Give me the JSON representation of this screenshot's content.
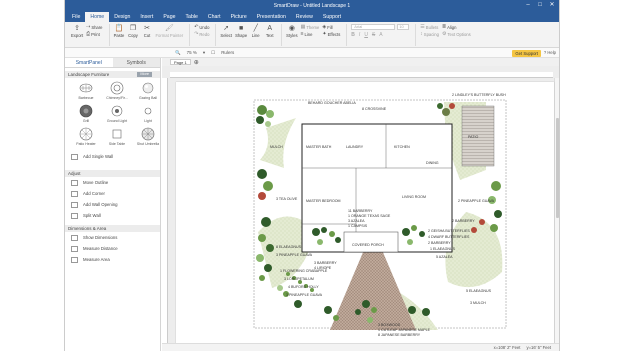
{
  "window": {
    "title": "SmartDraw - Untitled Landscape 1",
    "controls": [
      "–",
      "□",
      "✕"
    ]
  },
  "menu": {
    "items": [
      "File",
      "Home",
      "Design",
      "Insert",
      "Page",
      "Table",
      "Chart",
      "Picture",
      "Presentation",
      "Review",
      "Support"
    ],
    "active": "Home"
  },
  "ribbon": {
    "export": "Export",
    "share": "Share",
    "print": "Print",
    "paste": "Paste",
    "copy": "Copy",
    "cut": "Cut",
    "format_painter": "Format Painter",
    "undo": "Undo",
    "redo": "Redo",
    "select": "Select",
    "shape": "Shape",
    "line": "Line",
    "text": "Text",
    "styles": "Styles",
    "theme": "Theme",
    "fill": "Fill",
    "line_style": "Line",
    "effects": "Effects",
    "font": "Arial",
    "font_size": "10",
    "bullets": "Bullets",
    "align": "Align",
    "spacing": "Spacing",
    "text_options": "Text Options"
  },
  "toolbar2": {
    "zoom": "75 %",
    "rulers": "Rulers",
    "get_support": "Get Support",
    "help": "Help"
  },
  "sidebar": {
    "tabs": [
      "SmartPanel",
      "Symbols"
    ],
    "section": "Landscape Furniture",
    "more": "More",
    "symbols": [
      "Barbecue",
      "Chimney/Fir...",
      "Gazing Ball",
      "Grill",
      "Ground Light",
      "Light",
      "Patio Heater",
      "Side Table",
      "Shut Umbrella"
    ],
    "add_single_wall": "Add Single Wall",
    "adjust_title": "Adjust",
    "adjust_items": [
      "Move Outline",
      "Add Corner",
      "Add Wall Opening",
      "Split Wall"
    ],
    "dims_title": "Dimensions & Area",
    "dims_items": [
      "Show Dimensions",
      "Measure Distance",
      "Measure Area"
    ]
  },
  "canvas": {
    "page_tab": "Page 1"
  },
  "status": {
    "left": "x=108' 2\" Feet",
    "right": "y=16' 5\" Feet"
  },
  "plan": {
    "rooms": [
      "MASTER BATH",
      "LAUNDRY",
      "KITCHEN",
      "DINING",
      "MASTER BEDROOM",
      "LIVING ROOM",
      "COVERED PORCH"
    ],
    "top_labels": [
      "BEHARD GOUCHER ABELIA",
      "8 CROSSVINE",
      "2 LINDLEY'S BUTTERFLY BUSH",
      "PATIO"
    ],
    "left_labels": [
      "MULCH",
      "3 TEA OLIVE",
      "8 ELAEAGNUS",
      "3 PINEAPPLE GUAVA",
      "1 FLOWERING CRABAPPLE",
      "3 LOROPETALUM",
      "4 BUFORD HOLLY",
      "3 PINEAPPLE GUAVA"
    ],
    "center_labels": [
      "11 BARBERRY",
      "1 ORANGE TEXAS SAGE",
      "3 AZALEA",
      "1 CAMPSIS",
      "3 BARBERRY",
      "4 LIRIOPE"
    ],
    "right_labels": [
      "2 PINEAPPLE GUAVA",
      "2 BARBERRY",
      "2 GEISHA BUTTERFLIES",
      "4 DWARF BUTTERFLIES",
      "2 BARBERRY",
      "1 ELAEAGNUS",
      "5 AZALEA",
      "5 ELAEAGNUS",
      "3 MULCH"
    ],
    "bottom_labels": [
      "3 BOXWOOD",
      "1 CUTLEAF JAPANESE MAPLE",
      "8 JAPANESE BARBERRY"
    ]
  }
}
